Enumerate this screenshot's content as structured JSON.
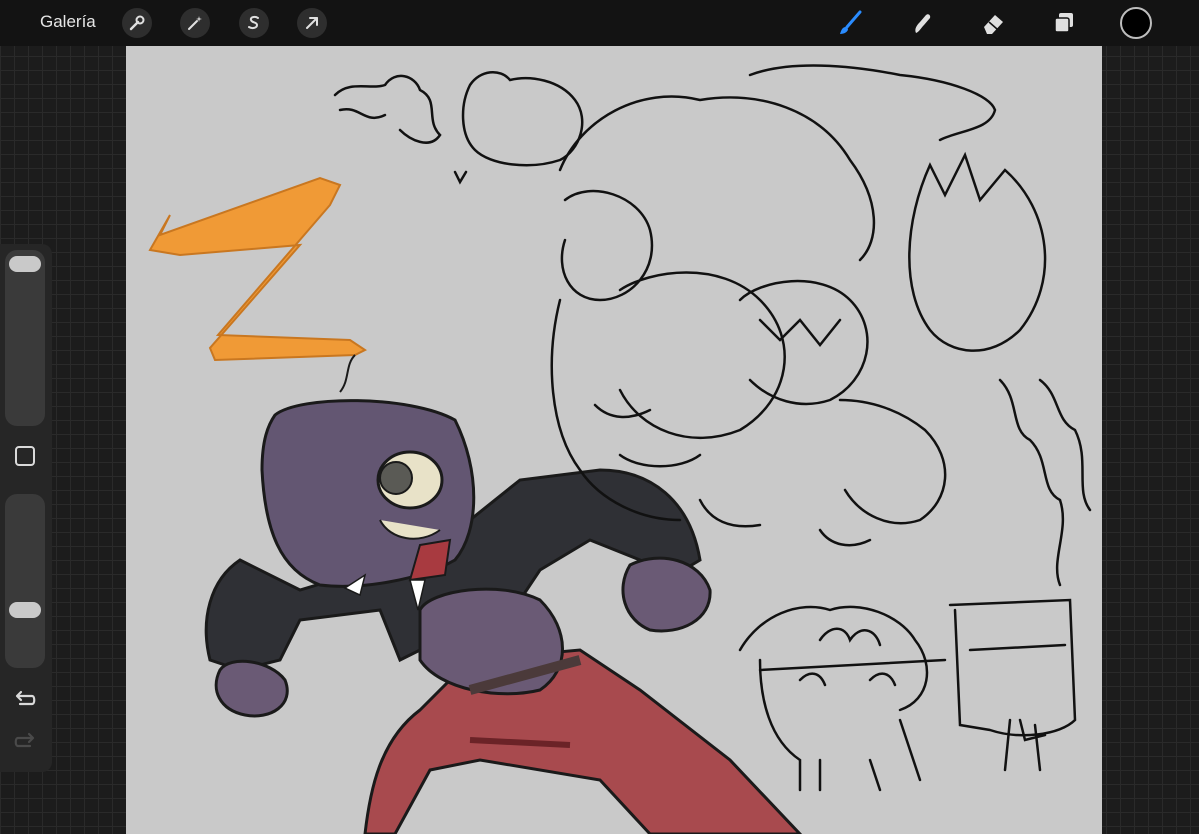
{
  "topbar": {
    "gallery_label": "Galería",
    "left_tools": [
      "wrench-icon",
      "magic-wand-icon",
      "selection-s-icon",
      "transform-arrow-icon"
    ],
    "right_tools": [
      "brush-icon",
      "smudge-icon",
      "eraser-icon",
      "layers-icon"
    ],
    "active_tool": "brush",
    "accent_color": "#2a8cff",
    "current_color": "#000000"
  },
  "sidebar": {
    "brush_size_level": 0.0,
    "opacity_level": 0.0,
    "icons": [
      "modifier-square-icon",
      "undo-icon",
      "redo-icon"
    ]
  },
  "canvas": {
    "background": "#c9c9c9"
  }
}
